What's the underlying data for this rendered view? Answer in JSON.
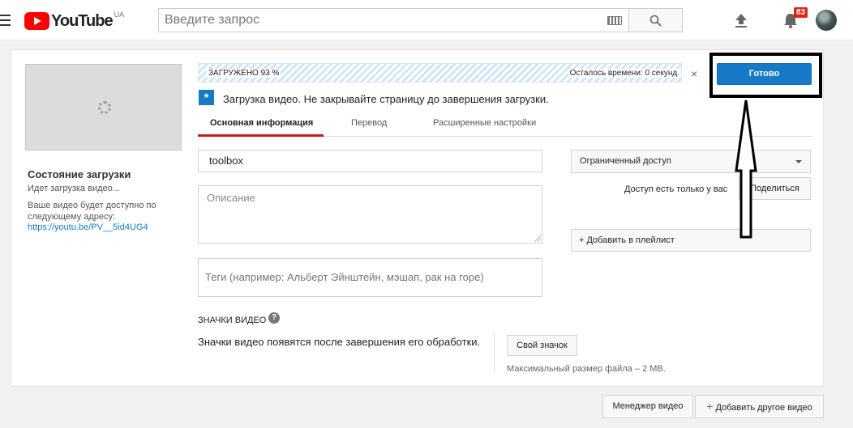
{
  "header": {
    "logo_text": "YouTube",
    "logo_country": "UA",
    "search_placeholder": "Введите запрос",
    "notifications_count": "83"
  },
  "sidebar": {
    "status_title": "Состояние загрузки",
    "status_sub": "Идет загрузка видео...",
    "availability_text": "Ваше видео будет доступно по следующему адресу:",
    "video_link": "https://youtu.be/PV__5id4UG4"
  },
  "upload": {
    "progress_label": "ЗАГРУЖЕНО 93 %",
    "progress_percent": 93,
    "time_left": "Осталось времени: 0 секунд.",
    "close_symbol": "×",
    "done_label": "Готово",
    "info_text": "Загрузка видео. Не закрывайте страницу до завершения загрузки."
  },
  "tabs": [
    {
      "label": "Основная информация",
      "active": true
    },
    {
      "label": "Перевод",
      "active": false
    },
    {
      "label": "Расширенные настройки",
      "active": false
    }
  ],
  "form": {
    "title_value": "toolbox",
    "description_placeholder": "Описание",
    "tags_placeholder": "Теги (например: Альберт Эйнштейн, мэшап, рак на горе)",
    "privacy_value": "Ограниченный доступ",
    "access_text": "Доступ есть только у вас",
    "share_label": "Поделиться",
    "playlist_label": "+ Добавить в плейлист"
  },
  "thumbnails": {
    "title": "ЗНАЧКИ ВИДЕО",
    "help_symbol": "?",
    "note": "Значки видео появятся после завершения его обработки.",
    "custom_button": "Свой значок",
    "max_size": "Максимальный размер файла – 2 MB."
  },
  "footer": {
    "manager_label": "Менеджер видео",
    "add_video_label": "Добавить другое видео"
  },
  "colors": {
    "brand_red": "#ff0000",
    "accent_blue": "#167ac6",
    "tab_underline": "#cc181e",
    "badge_red": "#e62117"
  }
}
